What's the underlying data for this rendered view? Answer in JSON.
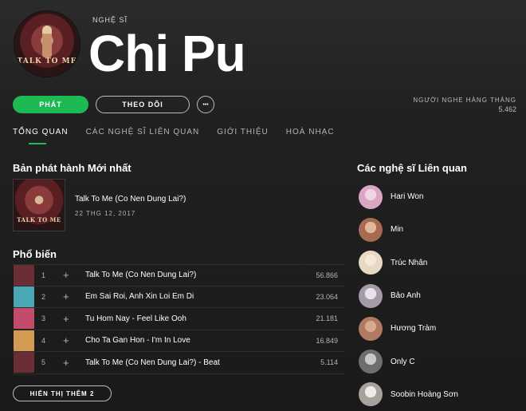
{
  "artist": {
    "overline": "NGHỆ SĨ",
    "name": "Chi Pu",
    "avatar_text": "TALK TO ME",
    "monthly_listeners_label": "NGƯỜI NGHE HÀNG THÁNG",
    "monthly_listeners": "5.462"
  },
  "actions": {
    "play_label": "PHÁT",
    "follow_label": "THEO DÕI",
    "more_label": "•••",
    "show_more_label": "HIỂN THỊ THÊM 2"
  },
  "tabs": [
    {
      "label": "TỔNG QUAN",
      "active": true
    },
    {
      "label": "CÁC NGHỆ SĨ LIÊN QUAN",
      "active": false
    },
    {
      "label": "GIỚI THIỆU",
      "active": false
    },
    {
      "label": "HOÀ NHẠC",
      "active": false
    }
  ],
  "latest_release": {
    "section_title": "Bản phát hành Mới nhất",
    "art_text": "TALK TO ME",
    "title": "Talk To Me (Co Nen Dung Lai?)",
    "date": "22 THG 12, 2017"
  },
  "popular": {
    "section_title": "Phổ biến",
    "add_symbol": "+",
    "tracks": [
      {
        "num": "1",
        "title": "Talk To Me (Co Nen Dung Lai?)",
        "plays": "56.866",
        "color": "#6b2e34"
      },
      {
        "num": "2",
        "title": "Em Sai Roi, Anh Xin Loi Em Di",
        "plays": "23.064",
        "color": "#4aa7b5"
      },
      {
        "num": "3",
        "title": "Tu Hom Nay - Feel Like Ooh",
        "plays": "21.181",
        "color": "#c54b6a"
      },
      {
        "num": "4",
        "title": "Cho Ta Gan Hon - I'm In Love",
        "plays": "16.849",
        "color": "#d49a52"
      },
      {
        "num": "5",
        "title": "Talk To Me (Co Nen Dung Lai?) - Beat",
        "plays": "5.114",
        "color": "#6b2e34"
      }
    ]
  },
  "related": {
    "section_title": "Các nghệ sĩ Liên quan",
    "artists": [
      {
        "name": "Hari Won",
        "color": "#d9a7c4"
      },
      {
        "name": "Min",
        "color": "#a86a52"
      },
      {
        "name": "Trúc Nhân",
        "color": "#e8d9c4"
      },
      {
        "name": "Bảo Anh",
        "color": "#cfc7d0"
      },
      {
        "name": "Hương Tràm",
        "color": "#b07a62"
      },
      {
        "name": "Only C",
        "color": "#8c8c8c"
      },
      {
        "name": "Soobin Hoàng Sơn",
        "color": "#d8d2cc"
      }
    ]
  },
  "colors": {
    "accent": "#1db954",
    "background": "#1e1e1e",
    "text_secondary": "#b3b3b3"
  }
}
